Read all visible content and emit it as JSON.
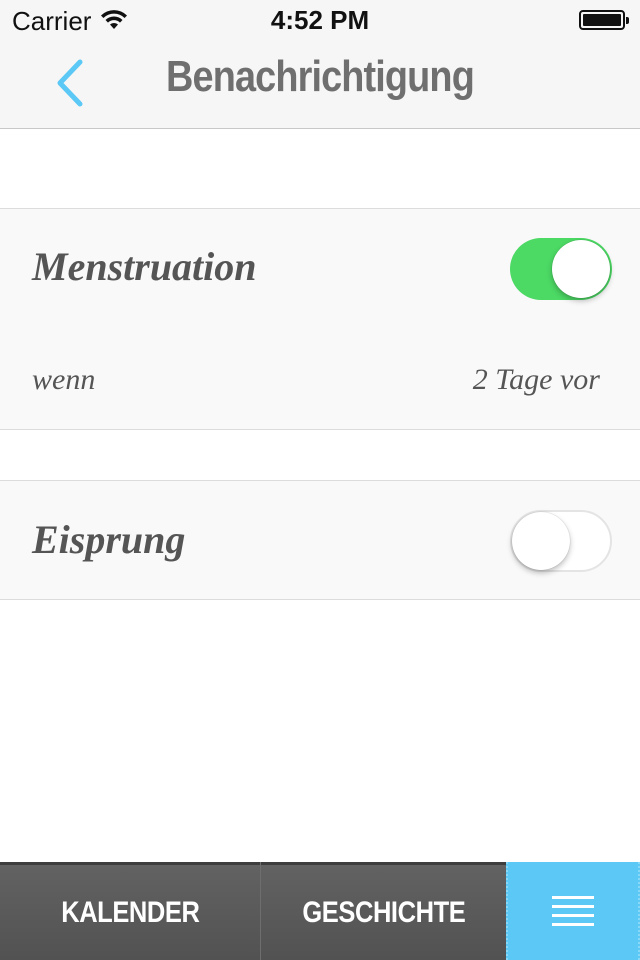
{
  "status_bar": {
    "carrier": "Carrier",
    "time": "4:52 PM",
    "wifi_icon": "wifi-icon",
    "battery_icon": "battery-icon"
  },
  "nav": {
    "title": "Benachrichtigung",
    "back_icon": "chevron-left-icon"
  },
  "settings": {
    "menstruation": {
      "label": "Menstruation",
      "enabled": true
    },
    "when": {
      "label": "wenn",
      "value": "2 Tage vor"
    },
    "ovulation": {
      "label": "Eisprung",
      "enabled": false
    }
  },
  "tabbar": {
    "calendar": "KALENDER",
    "history": "GESCHICHTE",
    "menu_icon": "menu-lines-icon"
  },
  "colors": {
    "accent": "#5bc8f5",
    "switch_on": "#4cd964",
    "tabbar": "#5a5a5a",
    "title_text": "#6f6f6f"
  }
}
